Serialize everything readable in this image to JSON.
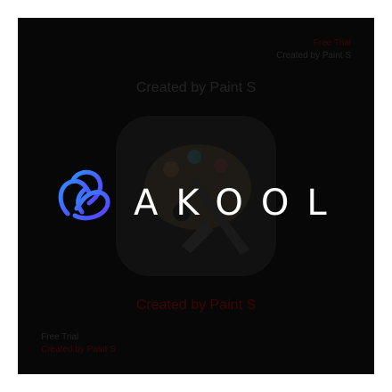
{
  "watermarks": {
    "top_right_line1": "Free Trial",
    "top_right_line2": "Created by Paint S",
    "upper_center": "Created by Paint S",
    "lower_center": "Created by Paint S",
    "bottom_left_line1": "Free Trial",
    "bottom_left_line2": "Created by Paint S"
  },
  "logo": {
    "text": "AKOOL",
    "mark": "interlocking-loops-icon",
    "mark_gradient": [
      "#2f8cff",
      "#5a3cff"
    ],
    "text_color": "#ffffff"
  },
  "app_icon": {
    "icon": "paint-palette-icon"
  },
  "colors": {
    "background": "#070707",
    "frame": "#ffffff",
    "watermark_red": "#3a0606",
    "watermark_dark": "#232323"
  }
}
